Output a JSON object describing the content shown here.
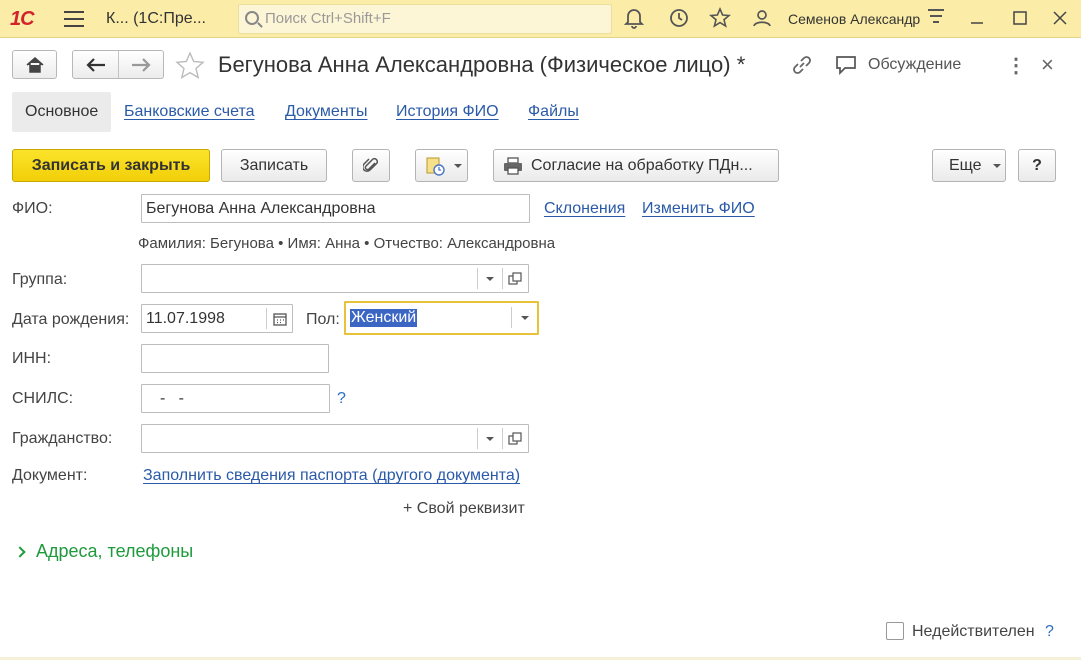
{
  "topbar": {
    "logo": "1С",
    "app_title": "К...   (1С:Пре...",
    "search_placeholder": "Поиск Ctrl+Shift+F",
    "user": "Семенов Александр"
  },
  "window": {
    "title": "Бегунова Анна Александровна (Физическое лицо) *",
    "discussion_label": "Обсуждение",
    "close": "×",
    "more": "⋮"
  },
  "tabs": [
    {
      "label": "Основное",
      "active": true
    },
    {
      "label": "Банковские счета"
    },
    {
      "label": "Документы"
    },
    {
      "label": "История ФИО"
    },
    {
      "label": "Файлы"
    }
  ],
  "toolbar": {
    "save_close": "Записать и закрыть",
    "save": "Записать",
    "consent": "Согласие на обработку ПДн...",
    "more": "Еще",
    "help": "?"
  },
  "form": {
    "fio": {
      "label": "ФИО:",
      "value": "Бегунова Анна Александровна"
    },
    "declensions_link": "Склонения",
    "change_fio_link": "Изменить ФИО",
    "fio_parts": "Фамилия: Бегунова • Имя: Анна • Отчество: Александровна",
    "group": {
      "label": "Группа:",
      "value": ""
    },
    "birth_date": {
      "label": "Дата рождения:",
      "value": "11.07.1998"
    },
    "gender": {
      "label": "Пол:",
      "value": "Женский"
    },
    "inn": {
      "label": "ИНН:",
      "value": ""
    },
    "snils": {
      "label": "СНИЛС:",
      "value": "-   -",
      "help": "?"
    },
    "citizenship": {
      "label": "Гражданство:",
      "value": ""
    },
    "document": {
      "label": "Документ:",
      "link": "Заполнить сведения паспорта (другого документа)"
    },
    "custom_attr": "+ Свой реквизит"
  },
  "section": {
    "addresses": "Адреса, телефоны"
  },
  "footer": {
    "invalid_label": "Недействителен",
    "help": "?"
  },
  "colors": {
    "topbar": "#fbeda8",
    "primary_button": "#f5d812",
    "link": "#2a5aa8",
    "section": "#1e9a3c",
    "focus_border": "#e8c23a",
    "selection": "#3b66c4"
  }
}
